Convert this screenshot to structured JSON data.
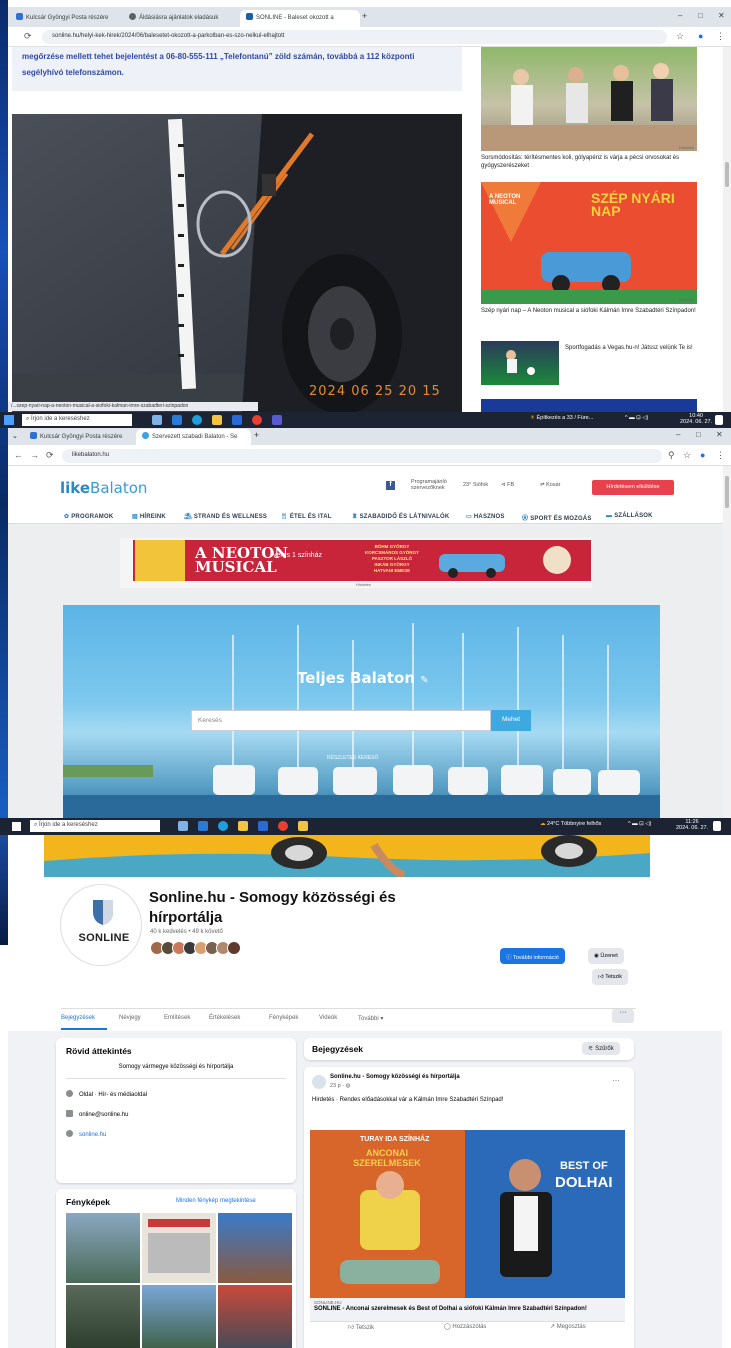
{
  "screen1": {
    "tabs": [
      {
        "label": "Kulcsár Gyöngyi Posta részére",
        "close": "×"
      },
      {
        "label": "Áldásiásra ajánlatok eladásuk",
        "close": "×"
      },
      {
        "label": "SONLINE - Baleset okozott a",
        "close": "×"
      }
    ],
    "new_tab": "+",
    "window_controls": {
      "min": "–",
      "max": "□",
      "close": "✕"
    },
    "url": "sonline.hu/helyi-kek-hirek/2024/06/balesetet-okozott-a-parkolban-es-szo-nelkul-elhajtott",
    "article_text": "megőrzése mellett tehet bejelentést a 06-80-555-111 „Telefontanú” zöld számán, továbbá a 112 központi segélyhívó telefonszámon.",
    "photo_stamp": "2024  06  25 20  15",
    "hover_url": "/...szep-nyari-nap-a-neoton-musical-a-siofoki-kalman-imre-szabadteri-szinpadon",
    "side": [
      {
        "caption": "Sorsmódosítás: térítésmentes koli, gólyapénz is várja a pécsi orvosokat és gyógyszerészeket",
        "tag": "Hirdetés"
      },
      {
        "caption": "Szép nyári nap – A Neoton musical a siófoki Kálmán Imre Szabadtéri Színpadon!",
        "tag": "Hirdetés",
        "art_title": "SZÉP NYÁRI NAP",
        "art_sub": "A NEOTON MUSICAL"
      },
      {
        "caption": "Sportfogadás a Vegas.hu-n! Játssz velünk Te is!",
        "tag": "Hirdetés"
      }
    ],
    "taskbar": {
      "search": "Írjon ide a kereséshez",
      "weather": "Építkezés a 33 / Füre...",
      "time": "10:40",
      "date": "2024. 06. 27."
    }
  },
  "screen2": {
    "tabs": [
      {
        "label": "Kulcsár Gyöngyi Posta részére",
        "close": "×"
      },
      {
        "label": "Szervezett szabadi Balaton - Se",
        "close": "×"
      }
    ],
    "new_tab": "+",
    "url": "likebalaton.hu",
    "logo_like": "like",
    "logo_balaton": "Balaton",
    "header_items": [
      "Programajánló szervezőknek",
      "23° Siófok",
      "FB",
      "Kedvenc",
      "Kosár"
    ],
    "register_button": "Hírdetésem elküldése",
    "menu": [
      "PROGRAMOK",
      "HÍREINK",
      "STRAND ÉS WELLNESS",
      "ÉTEL ÉS ITAL",
      "SZABADIDŐ ÉS LÁTNIVALÓK",
      "HASZNOS",
      "SPORT ÉS MOZGÁS",
      "SZÁLLÁSOK"
    ],
    "ad": {
      "line1": "A NEOTON",
      "line2": "MUSICAL",
      "sub": "veres 1 színház",
      "credits": "BÖHM GYÖRGY\nKORCSMÁROS GYÖRGY\nPASZTOR LÁSZLÓ\nINKÁB GYÖRGY\nHATVANI EMESE",
      "label": "Hirdetés"
    },
    "hero": {
      "title": "Teljes Balaton",
      "search_placeholder": "Keresés",
      "go_button": "Mehet",
      "advanced": "RÉSZLETES KERESŐ"
    },
    "taskbar": {
      "search": "Írjon ide a kereséshez",
      "weather": "24°C Többnyire felhős",
      "time": "11:26",
      "date": "2024. 06. 27."
    }
  },
  "screen3": {
    "page_name": "Sonline.hu - Somogy közösségi és hírportálja",
    "logo_text": "SONLINE",
    "followers": "40 k kedvelés • 49 k követő",
    "buttons": {
      "info": "További információ",
      "message": "Üzenet",
      "like": "Tetszik"
    },
    "tabs": [
      "Bejegyzések",
      "Névjegy",
      "Említések",
      "Értékelések",
      "Fényképek",
      "Videók",
      "További ▾"
    ],
    "more_dots": "···",
    "intro": {
      "title": "Rövid áttekintés",
      "desc": "Somogy vármegye közösségi és hírportálja",
      "rows": [
        "Oldal · Hír- és médiaoldal",
        "online@sonline.hu",
        "sonline.hu"
      ]
    },
    "photos": {
      "title": "Fényképek",
      "link": "Minden fénykép megtekintése"
    },
    "posts": {
      "title": "Bejegyzések",
      "filter": "Szűrők",
      "author": "Sonline.hu - Somogy közösségi és hírportálja",
      "time": "23 p · ",
      "text": "Hirdetés · Rendes előadásokkal vár a Kálmán Imre Szabadtéri Színpad!",
      "img_left": "ANCONAI SZERELMESEK",
      "img_left_top": "TURAY IDA SZÍNHÁZ",
      "img_right_a": "BEST OF",
      "img_right_b": "DOLHAI",
      "link_domain": "SONLINE.HU",
      "link_title": "SONLINE - Anconai szerelmesek és Best of Dolhai a siófoki Kálmán Imre Szabadtéri Színpadon!",
      "actions": [
        "Tetszik",
        "Hozzászólás",
        "Megosztás"
      ]
    }
  },
  "colors": {
    "fb_blue": "#1b74e4",
    "lb_blue": "#2c89c9",
    "lb_red": "#e8414d",
    "taskbar": "#1c2333"
  }
}
